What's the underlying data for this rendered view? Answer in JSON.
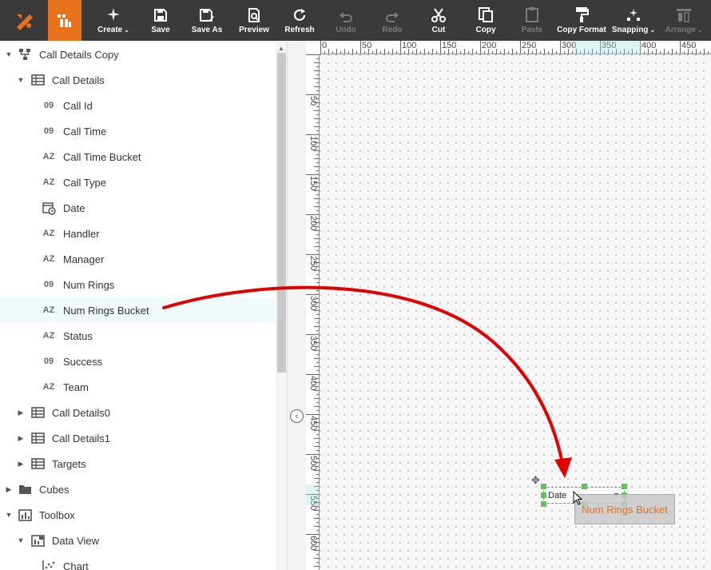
{
  "toolbar": {
    "buttons": [
      {
        "id": "create",
        "label": "Create",
        "icon": "sparkle-icon",
        "has_caret": true,
        "disabled": false
      },
      {
        "id": "save",
        "label": "Save",
        "icon": "save-icon",
        "disabled": false
      },
      {
        "id": "save_as",
        "label": "Save As",
        "icon": "save-as-icon",
        "disabled": false
      },
      {
        "id": "preview",
        "label": "Preview",
        "icon": "preview-icon",
        "disabled": false
      },
      {
        "id": "refresh",
        "label": "Refresh",
        "icon": "refresh-icon",
        "disabled": false
      },
      {
        "id": "undo",
        "label": "Undo",
        "icon": "undo-icon",
        "disabled": true
      },
      {
        "id": "redo",
        "label": "Redo",
        "icon": "redo-icon",
        "disabled": true
      },
      {
        "id": "cut",
        "label": "Cut",
        "icon": "scissors-icon",
        "disabled": false
      },
      {
        "id": "copy",
        "label": "Copy",
        "icon": "copy-icon",
        "disabled": false
      },
      {
        "id": "paste",
        "label": "Paste",
        "icon": "clipboard-icon",
        "disabled": true
      },
      {
        "id": "copy_format",
        "label": "Copy Format",
        "icon": "paint-roller-icon",
        "disabled": false
      },
      {
        "id": "snapping",
        "label": "Snapping",
        "icon": "snapping-icon",
        "has_caret": true,
        "disabled": false
      },
      {
        "id": "arrange",
        "label": "Arrange",
        "icon": "arrange-icon",
        "has_caret": true,
        "disabled": true
      }
    ]
  },
  "tree": {
    "rows": [
      {
        "label": "Call Details Copy",
        "icon": "worksheet-icon",
        "type_badge": "",
        "expanded": true,
        "level": 0
      },
      {
        "label": "Call Details",
        "icon": "table-icon",
        "type_badge": "",
        "expanded": true,
        "level": 1
      },
      {
        "label": "Call Id",
        "icon": "number-type-icon",
        "type_badge": "09",
        "level": 2
      },
      {
        "label": "Call Time",
        "icon": "number-type-icon",
        "type_badge": "09",
        "level": 2
      },
      {
        "label": "Call Time Bucket",
        "icon": "text-type-icon",
        "type_badge": "AZ",
        "level": 2
      },
      {
        "label": "Call Type",
        "icon": "text-type-icon",
        "type_badge": "AZ",
        "level": 2
      },
      {
        "label": "Date",
        "icon": "date-type-icon",
        "type_badge": "",
        "level": 2
      },
      {
        "label": "Handler",
        "icon": "text-type-icon",
        "type_badge": "AZ",
        "level": 2
      },
      {
        "label": "Manager",
        "icon": "text-type-icon",
        "type_badge": "AZ",
        "level": 2
      },
      {
        "label": "Num Rings",
        "icon": "number-type-icon",
        "type_badge": "09",
        "level": 2
      },
      {
        "label": "Num Rings Bucket",
        "icon": "text-type-icon",
        "type_badge": "AZ",
        "level": 2,
        "selected": true
      },
      {
        "label": "Status",
        "icon": "text-type-icon",
        "type_badge": "AZ",
        "level": 2
      },
      {
        "label": "Success",
        "icon": "number-type-icon",
        "type_badge": "09",
        "level": 2
      },
      {
        "label": "Team",
        "icon": "text-type-icon",
        "type_badge": "AZ",
        "level": 2
      },
      {
        "label": "Call Details0",
        "icon": "table-icon",
        "type_badge": "",
        "expanded": false,
        "level": 1
      },
      {
        "label": "Call Details1",
        "icon": "table-icon",
        "type_badge": "",
        "expanded": false,
        "level": 1
      },
      {
        "label": "Targets",
        "icon": "table-icon",
        "type_badge": "",
        "expanded": false,
        "level": 1
      },
      {
        "label": "Cubes",
        "icon": "folder-icon",
        "type_badge": "",
        "expanded": false,
        "level": 0
      },
      {
        "label": "Toolbox",
        "icon": "toolbox-icon",
        "type_badge": "",
        "expanded": true,
        "level": 0
      },
      {
        "label": "Data View",
        "icon": "data-view-icon",
        "type_badge": "",
        "expanded": true,
        "level": 1
      },
      {
        "label": "Chart",
        "icon": "chart-icon",
        "type_badge": "",
        "level": 2
      }
    ]
  },
  "ruler": {
    "top_labels": [
      "0",
      "50",
      "100",
      "150",
      "200",
      "250",
      "300",
      "350",
      "400",
      "450"
    ],
    "left_labels": [
      "50",
      "100",
      "150",
      "200",
      "250",
      "300",
      "350",
      "400",
      "450",
      "500",
      "550",
      "600"
    ]
  },
  "canvas": {
    "date_widget_value": "Date",
    "ghost_label": "Num Rings Bucket"
  },
  "colors": {
    "toolbar_bg": "#3a3a3a",
    "accent": "#e8711c",
    "selection_handle": "#5ec35e",
    "drag_arrow": "#e00000"
  }
}
